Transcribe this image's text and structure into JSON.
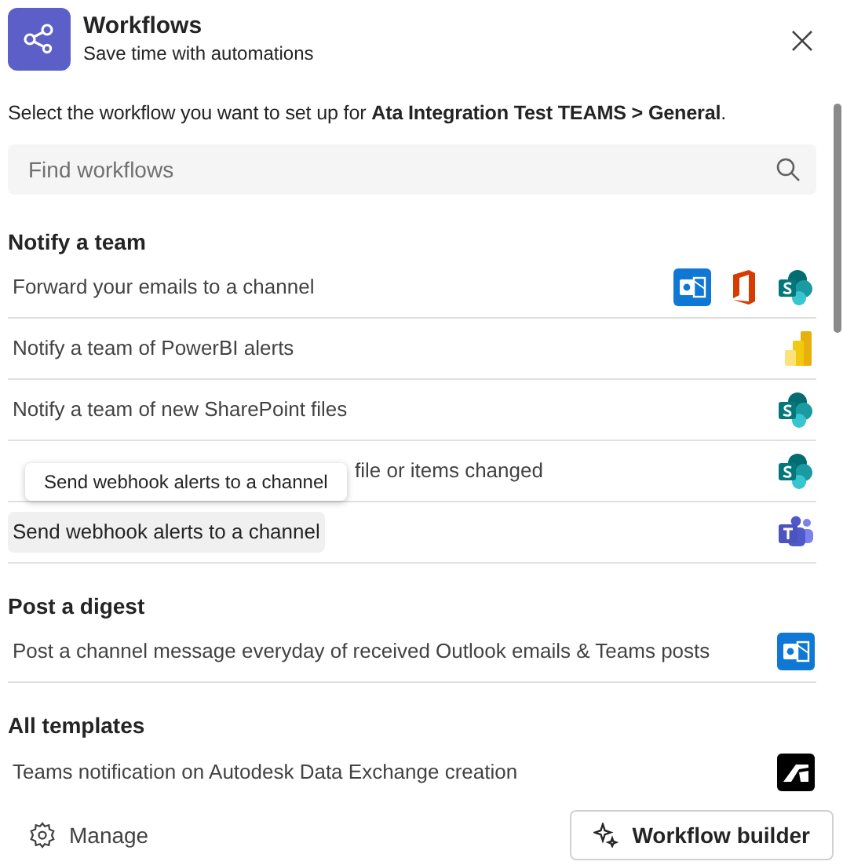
{
  "header": {
    "title": "Workflows",
    "subtitle": "Save time with automations"
  },
  "intro": "Select the workflow you want to set up for **Ata Integration Test TEAMS > General**.",
  "search": {
    "placeholder": "Find workflows"
  },
  "sections": [
    {
      "heading": "Notify a team",
      "items": [
        {
          "label": "Forward your emails to a channel",
          "hovered": false,
          "covered": false,
          "apps": [
            {
              "kind": "outlook"
            },
            {
              "kind": "office"
            },
            {
              "kind": "sharepoint"
            }
          ]
        },
        {
          "label": "Notify a team of PowerBI alerts",
          "hovered": false,
          "covered": false,
          "apps": [
            {
              "kind": "powerbi"
            }
          ]
        },
        {
          "label": "Notify a team of new SharePoint files",
          "hovered": false,
          "covered": false,
          "apps": [
            {
              "kind": "sharepoint"
            }
          ]
        },
        {
          "label": "file or items changed",
          "hovered": false,
          "covered": true,
          "apps": [
            {
              "kind": "sharepoint"
            }
          ]
        },
        {
          "label": "Send webhook alerts to a channel",
          "hovered": true,
          "covered": false,
          "apps": [
            {
              "kind": "teams"
            }
          ]
        }
      ]
    },
    {
      "heading": "Post a digest",
      "items": [
        {
          "label": "Post a channel message everyday of received Outlook emails & Teams posts",
          "hovered": false,
          "covered": false,
          "apps": [
            {
              "kind": "outlook"
            }
          ]
        }
      ]
    },
    {
      "heading": "All templates",
      "items": [
        {
          "label": "Teams notification on Autodesk Data Exchange creation",
          "hovered": false,
          "covered": false,
          "apps": [
            {
              "kind": "autodesk"
            }
          ]
        }
      ]
    }
  ],
  "tooltip": "Send webhook alerts to a channel",
  "footer": {
    "manage": "Manage",
    "builder": "Workflow builder"
  }
}
